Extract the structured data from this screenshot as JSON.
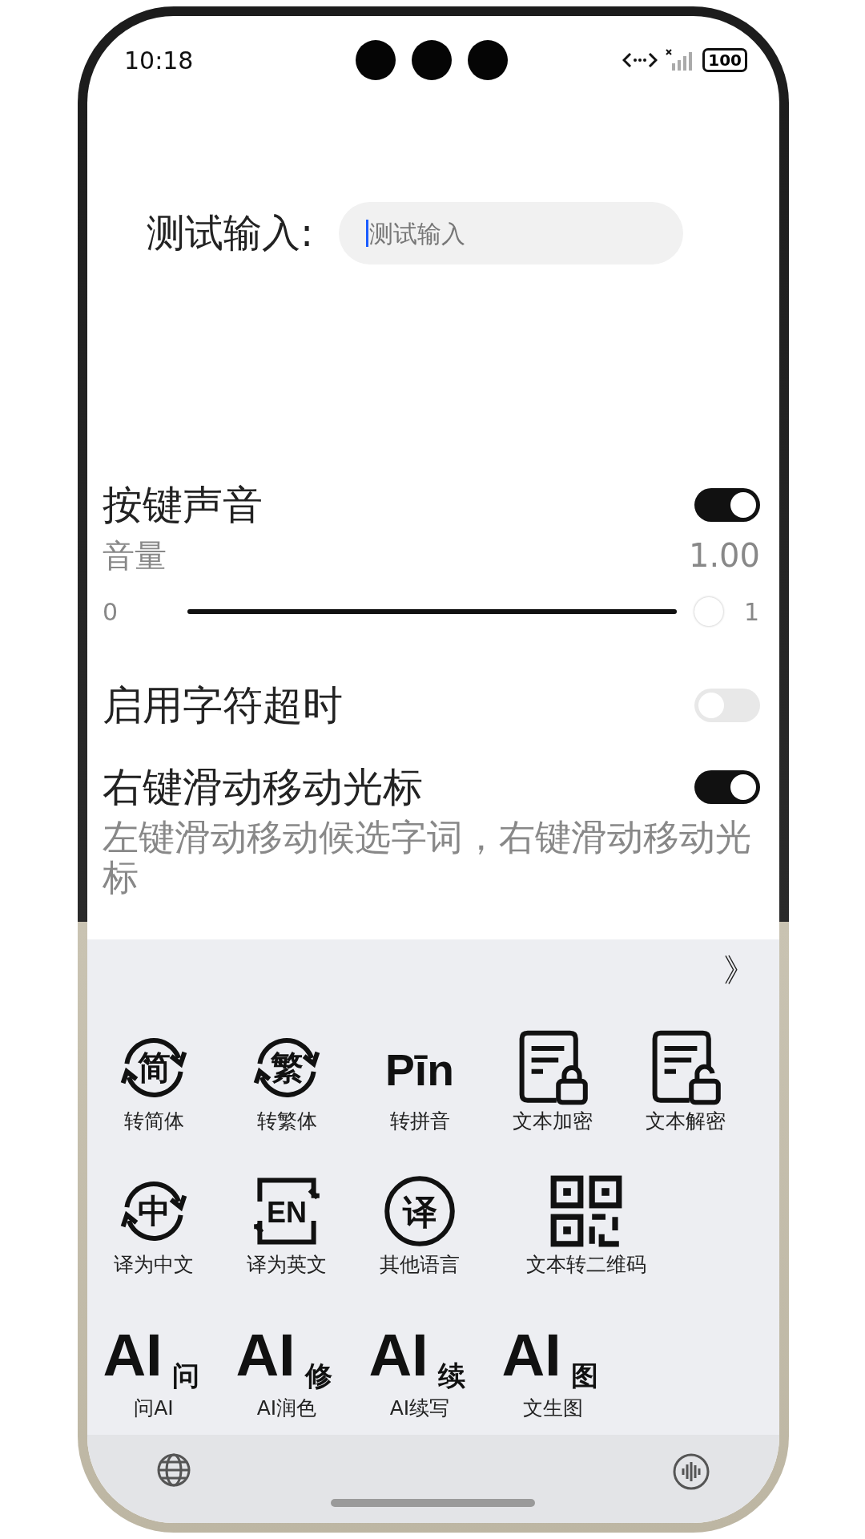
{
  "status_bar": {
    "time": "10:18",
    "battery": "100"
  },
  "test_input": {
    "label": "测试输入:",
    "placeholder": "测试输入"
  },
  "settings": [
    {
      "kind": "toggle",
      "title": "按键声音",
      "on": true
    },
    {
      "kind": "slider",
      "label": "音量",
      "reading": "1.00",
      "min": "0",
      "max": "1",
      "level": 1.0
    },
    {
      "kind": "toggle",
      "title": "启用字符超时",
      "on": false
    },
    {
      "kind": "toggle",
      "title": "右键滑动移动光标",
      "on": true,
      "description": "左键滑动移动候选字词，右键滑动移动光标"
    }
  ],
  "toolbar": {
    "expand": "》",
    "rows": [
      [
        {
          "kind": "cycle",
          "icon_text": "简",
          "label": "转简体"
        },
        {
          "kind": "cycle",
          "icon_text": "繁",
          "label": "转繁体"
        },
        {
          "kind": "text",
          "icon_text": "Pīn",
          "label": "转拼音"
        },
        {
          "kind": "doc-lock",
          "label": "文本加密"
        },
        {
          "kind": "doc-unlock",
          "label": "文本解密"
        }
      ],
      [
        {
          "kind": "cycle",
          "icon_text": "中",
          "label": "译为中文"
        },
        {
          "kind": "frame",
          "icon_text": "EN",
          "label": "译为英文"
        },
        {
          "kind": "circle",
          "icon_text": "译",
          "label": "其他语言"
        },
        {
          "kind": "qr",
          "label": "文本转二维码"
        }
      ],
      [
        {
          "kind": "ai",
          "icon_text": "AI",
          "icon_sub": "问",
          "label": "问AI"
        },
        {
          "kind": "ai",
          "icon_text": "AI",
          "icon_sub": "修",
          "label": "AI润色"
        },
        {
          "kind": "ai",
          "icon_text": "AI",
          "icon_sub": "续",
          "label": "AI续写"
        },
        {
          "kind": "ai",
          "icon_text": "AI",
          "icon_sub": "图",
          "label": "文生图"
        }
      ]
    ]
  }
}
